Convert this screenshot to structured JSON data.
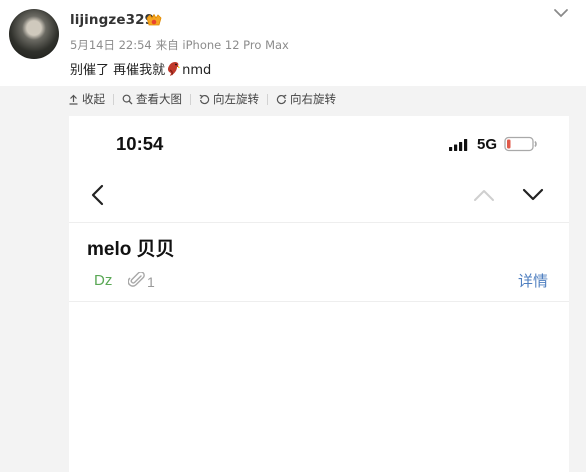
{
  "post": {
    "username": "lijingze329",
    "date": "5月14日 22:54",
    "source": "来自 iPhone 12 Pro Max",
    "text_before": "别催了 再催我就",
    "emoji": "parrot-emoji",
    "text_after": "nmd"
  },
  "toolbar": {
    "collapse": "收起",
    "view_large": "查看大图",
    "rotate_left": "向左旋转",
    "rotate_right": "向右旋转"
  },
  "phone": {
    "status": {
      "time": "10:54",
      "network": "5G"
    },
    "email": {
      "subject": "melo 贝贝",
      "sender": "Dz",
      "attachment_count": "1",
      "details": "详情"
    }
  },
  "colors": {
    "sender_green": "#5aa855",
    "link_blue": "#4f7fc0",
    "battery_red": "#e05a4a",
    "media_bg": "#f3f3f3"
  }
}
